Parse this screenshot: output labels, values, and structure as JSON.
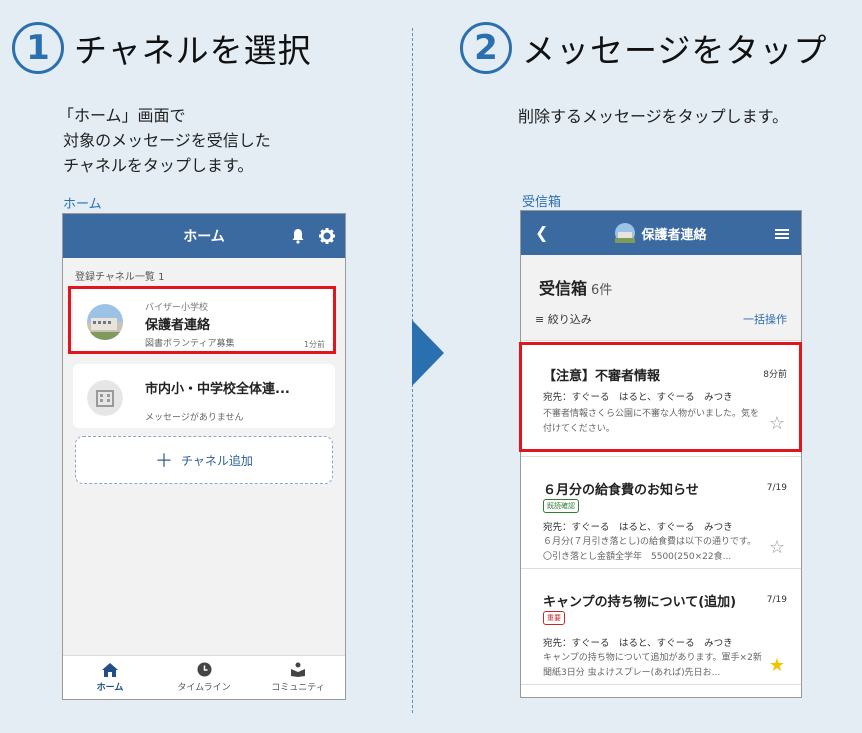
{
  "step1": {
    "num": "1",
    "text": "チャネルを選択"
  },
  "step2": {
    "num": "2",
    "text": "メッセージをタップ"
  },
  "desc1": "「ホーム」画面で\n 対象のメッセージを受信した\n チャネルをタップします。",
  "desc2": "削除するメッセージをタップします。",
  "label1": "ホーム",
  "label2": "受信箱",
  "home": {
    "title": "ホーム",
    "section": "登録チャネル一覧 1",
    "cards": [
      {
        "school": "バイザー小学校",
        "channel": "保護者連絡",
        "sub": "図書ボランティア募集",
        "time": "1分前"
      },
      {
        "channel": "市内小・中学校全体連...",
        "sub": "メッセージがありません"
      }
    ],
    "add": "チャネル追加",
    "tabs": [
      "ホーム",
      "タイムライン",
      "コミュニティ"
    ]
  },
  "inbox": {
    "channel": "保護者連絡",
    "title": "受信箱",
    "count": "6件",
    "filter": "絞り込み",
    "bulk": "一括操作",
    "messages": [
      {
        "title": "【注意】不審者情報",
        "time": "8分前",
        "to": "宛先：すぐーる　はると、すぐーる　みつき",
        "body": "不審者情報さくら公園に不審な人物がいました。気を付けてください。"
      },
      {
        "title": "６月分の給食費のお知らせ",
        "time": "7/19",
        "tag": "既読確認",
        "to": "宛先：すぐーる　はると、すぐーる　みつき",
        "body": "６月分(７月引き落とし)の給食費は以下の通りです。〇引き落とし金額全学年　5500(250×22食..."
      },
      {
        "title": "キャンプの持ち物について(追加)",
        "time": "7/19",
        "tag": "重要",
        "to": "宛先：すぐーる　はると、すぐーる　みつき",
        "body": "キャンプの持ち物について追加があります。軍手×2新聞紙3日分 虫よけスプレー(あれば)先日お..."
      }
    ]
  },
  "colors": {
    "accent": "#2a6fb0",
    "appbar": "#3b6aa0",
    "highlight": "#e0161c",
    "star_on": "#f2c400"
  }
}
